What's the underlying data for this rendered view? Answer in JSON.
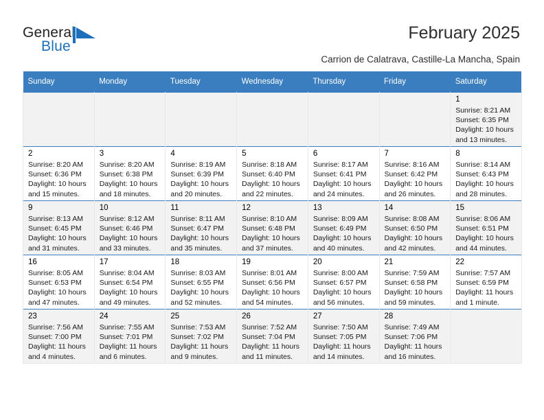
{
  "brand": {
    "name_part1": "General",
    "name_part2": "Blue",
    "logo_icon": "blue-triangle-flag-icon",
    "accent_color": "#1c6fba"
  },
  "header": {
    "title": "February 2025",
    "subtitle": "Carrion de Calatrava, Castille-La Mancha, Spain"
  },
  "calendar": {
    "header_background": "#3a7ebf",
    "header_text_color": "#ffffff",
    "columns": [
      "Sunday",
      "Monday",
      "Tuesday",
      "Wednesday",
      "Thursday",
      "Friday",
      "Saturday"
    ],
    "weeks": [
      [
        {
          "day": "",
          "empty": true
        },
        {
          "day": "",
          "empty": true
        },
        {
          "day": "",
          "empty": true
        },
        {
          "day": "",
          "empty": true
        },
        {
          "day": "",
          "empty": true
        },
        {
          "day": "",
          "empty": true
        },
        {
          "day": "1",
          "sunrise": "Sunrise: 8:21 AM",
          "sunset": "Sunset: 6:35 PM",
          "daylight1": "Daylight: 10 hours",
          "daylight2": "and 13 minutes."
        }
      ],
      [
        {
          "day": "2",
          "sunrise": "Sunrise: 8:20 AM",
          "sunset": "Sunset: 6:36 PM",
          "daylight1": "Daylight: 10 hours",
          "daylight2": "and 15 minutes."
        },
        {
          "day": "3",
          "sunrise": "Sunrise: 8:20 AM",
          "sunset": "Sunset: 6:38 PM",
          "daylight1": "Daylight: 10 hours",
          "daylight2": "and 18 minutes."
        },
        {
          "day": "4",
          "sunrise": "Sunrise: 8:19 AM",
          "sunset": "Sunset: 6:39 PM",
          "daylight1": "Daylight: 10 hours",
          "daylight2": "and 20 minutes."
        },
        {
          "day": "5",
          "sunrise": "Sunrise: 8:18 AM",
          "sunset": "Sunset: 6:40 PM",
          "daylight1": "Daylight: 10 hours",
          "daylight2": "and 22 minutes."
        },
        {
          "day": "6",
          "sunrise": "Sunrise: 8:17 AM",
          "sunset": "Sunset: 6:41 PM",
          "daylight1": "Daylight: 10 hours",
          "daylight2": "and 24 minutes."
        },
        {
          "day": "7",
          "sunrise": "Sunrise: 8:16 AM",
          "sunset": "Sunset: 6:42 PM",
          "daylight1": "Daylight: 10 hours",
          "daylight2": "and 26 minutes."
        },
        {
          "day": "8",
          "sunrise": "Sunrise: 8:14 AM",
          "sunset": "Sunset: 6:43 PM",
          "daylight1": "Daylight: 10 hours",
          "daylight2": "and 28 minutes."
        }
      ],
      [
        {
          "day": "9",
          "sunrise": "Sunrise: 8:13 AM",
          "sunset": "Sunset: 6:45 PM",
          "daylight1": "Daylight: 10 hours",
          "daylight2": "and 31 minutes."
        },
        {
          "day": "10",
          "sunrise": "Sunrise: 8:12 AM",
          "sunset": "Sunset: 6:46 PM",
          "daylight1": "Daylight: 10 hours",
          "daylight2": "and 33 minutes."
        },
        {
          "day": "11",
          "sunrise": "Sunrise: 8:11 AM",
          "sunset": "Sunset: 6:47 PM",
          "daylight1": "Daylight: 10 hours",
          "daylight2": "and 35 minutes."
        },
        {
          "day": "12",
          "sunrise": "Sunrise: 8:10 AM",
          "sunset": "Sunset: 6:48 PM",
          "daylight1": "Daylight: 10 hours",
          "daylight2": "and 37 minutes."
        },
        {
          "day": "13",
          "sunrise": "Sunrise: 8:09 AM",
          "sunset": "Sunset: 6:49 PM",
          "daylight1": "Daylight: 10 hours",
          "daylight2": "and 40 minutes."
        },
        {
          "day": "14",
          "sunrise": "Sunrise: 8:08 AM",
          "sunset": "Sunset: 6:50 PM",
          "daylight1": "Daylight: 10 hours",
          "daylight2": "and 42 minutes."
        },
        {
          "day": "15",
          "sunrise": "Sunrise: 8:06 AM",
          "sunset": "Sunset: 6:51 PM",
          "daylight1": "Daylight: 10 hours",
          "daylight2": "and 44 minutes."
        }
      ],
      [
        {
          "day": "16",
          "sunrise": "Sunrise: 8:05 AM",
          "sunset": "Sunset: 6:53 PM",
          "daylight1": "Daylight: 10 hours",
          "daylight2": "and 47 minutes."
        },
        {
          "day": "17",
          "sunrise": "Sunrise: 8:04 AM",
          "sunset": "Sunset: 6:54 PM",
          "daylight1": "Daylight: 10 hours",
          "daylight2": "and 49 minutes."
        },
        {
          "day": "18",
          "sunrise": "Sunrise: 8:03 AM",
          "sunset": "Sunset: 6:55 PM",
          "daylight1": "Daylight: 10 hours",
          "daylight2": "and 52 minutes."
        },
        {
          "day": "19",
          "sunrise": "Sunrise: 8:01 AM",
          "sunset": "Sunset: 6:56 PM",
          "daylight1": "Daylight: 10 hours",
          "daylight2": "and 54 minutes."
        },
        {
          "day": "20",
          "sunrise": "Sunrise: 8:00 AM",
          "sunset": "Sunset: 6:57 PM",
          "daylight1": "Daylight: 10 hours",
          "daylight2": "and 56 minutes."
        },
        {
          "day": "21",
          "sunrise": "Sunrise: 7:59 AM",
          "sunset": "Sunset: 6:58 PM",
          "daylight1": "Daylight: 10 hours",
          "daylight2": "and 59 minutes."
        },
        {
          "day": "22",
          "sunrise": "Sunrise: 7:57 AM",
          "sunset": "Sunset: 6:59 PM",
          "daylight1": "Daylight: 11 hours",
          "daylight2": "and 1 minute."
        }
      ],
      [
        {
          "day": "23",
          "sunrise": "Sunrise: 7:56 AM",
          "sunset": "Sunset: 7:00 PM",
          "daylight1": "Daylight: 11 hours",
          "daylight2": "and 4 minutes."
        },
        {
          "day": "24",
          "sunrise": "Sunrise: 7:55 AM",
          "sunset": "Sunset: 7:01 PM",
          "daylight1": "Daylight: 11 hours",
          "daylight2": "and 6 minutes."
        },
        {
          "day": "25",
          "sunrise": "Sunrise: 7:53 AM",
          "sunset": "Sunset: 7:02 PM",
          "daylight1": "Daylight: 11 hours",
          "daylight2": "and 9 minutes."
        },
        {
          "day": "26",
          "sunrise": "Sunrise: 7:52 AM",
          "sunset": "Sunset: 7:04 PM",
          "daylight1": "Daylight: 11 hours",
          "daylight2": "and 11 minutes."
        },
        {
          "day": "27",
          "sunrise": "Sunrise: 7:50 AM",
          "sunset": "Sunset: 7:05 PM",
          "daylight1": "Daylight: 11 hours",
          "daylight2": "and 14 minutes."
        },
        {
          "day": "28",
          "sunrise": "Sunrise: 7:49 AM",
          "sunset": "Sunset: 7:06 PM",
          "daylight1": "Daylight: 11 hours",
          "daylight2": "and 16 minutes."
        },
        {
          "day": "",
          "empty": true
        }
      ]
    ]
  }
}
